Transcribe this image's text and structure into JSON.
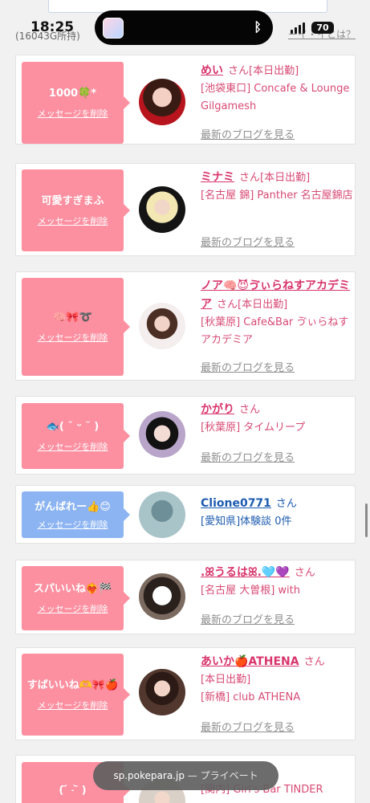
{
  "status_bar": {
    "time": "18:25",
    "battery": "70"
  },
  "header": {
    "left_text": "(16043G所持)",
    "right_text": "ーイ・イとは？"
  },
  "messages": [
    {
      "message": "1000🍀*",
      "delete_label": "メッセージを削除",
      "name": "めい",
      "san": "さん",
      "status": "[本日出勤]",
      "shop": "[池袋東口] Concafe & Lounge Gilgamesh",
      "blog_label": "最新のブログを見る"
    },
    {
      "message": "可愛すぎまふ",
      "delete_label": "メッセージを削除",
      "name": "ミナミ",
      "san": "さん",
      "status": "[本日出勤]",
      "shop": "[名古屋 錦] Panther 名古屋錦店",
      "blog_label": "最新のブログを見る"
    },
    {
      "message": "🧠🎀➰",
      "delete_label": "メッセージを削除",
      "name": "ノア🧠😈ゔぃらねすアカデミア",
      "san": "さん",
      "status": "[本日出勤]",
      "shop": "[秋葉原] Cafe&Bar ゔぃらねすアカデミア",
      "blog_label": "最新のブログを見る"
    },
    {
      "message": "🐟( ˘ ᵕ ˘ )",
      "delete_label": "メッセージを削除",
      "name": "かがり",
      "san": "さん",
      "status": "",
      "shop": "[秋葉原] タイムリープ",
      "blog_label": "最新のブログを見る"
    },
    {
      "message": "がんばれー👍😊",
      "delete_label": "メッセージを削除",
      "name": "Clione0771",
      "san": "さん",
      "status": "",
      "shop": "[愛知県]体験談 0件",
      "blog_label": ""
    },
    {
      "message": "スパいいね❤️‍🔥🏁",
      "delete_label": "メッセージを削除",
      "name": ".ꕤうるはꕤ.🩵💜",
      "san": "さん",
      "status": "",
      "shop": "[名古屋 大曽根] with",
      "blog_label": "最新のブログを見る"
    },
    {
      "message": "すばいいね🫶🎀🍎",
      "delete_label": "メッセージを削除",
      "name": "あいか🍎ATHENA",
      "san": "さん",
      "status": "[本日出勤]",
      "shop": "[新橋] club ATHENA",
      "blog_label": "最新のブログを見る"
    },
    {
      "message": "( ᷄ ˗ ᷅ )",
      "delete_label": "",
      "name": "",
      "san": "",
      "status": "",
      "shop": "[関内] Girl's Bar TINDER",
      "blog_label": ""
    }
  ],
  "url_bar": {
    "domain": "sp.pokepara.jp",
    "separator": "—",
    "mode": "プライベート"
  },
  "icons": [
    "bluetooth-icon",
    "signal-icon",
    "battery-icon",
    "app-icon"
  ]
}
